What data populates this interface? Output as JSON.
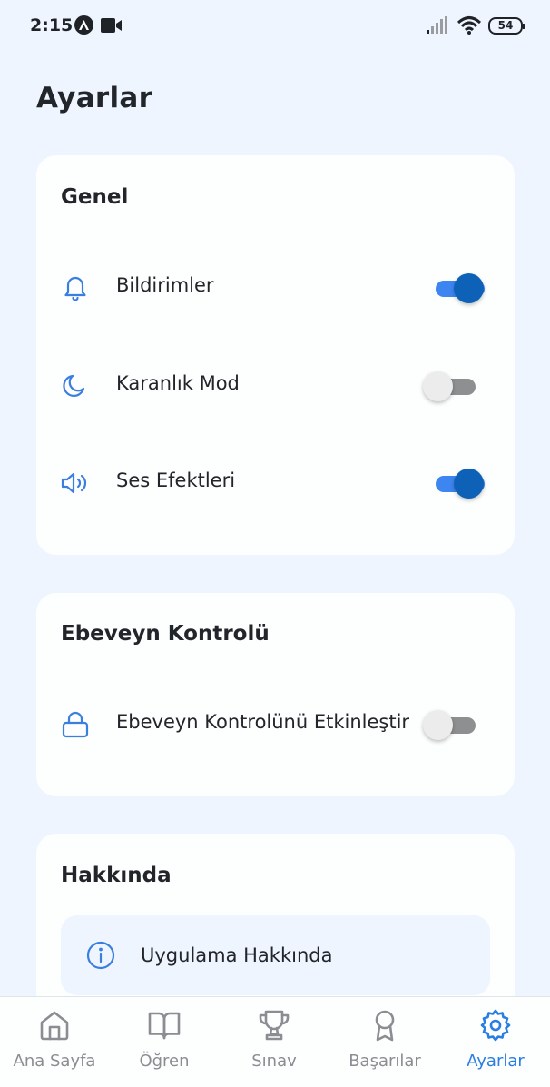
{
  "status_bar": {
    "time": "2:15",
    "battery": "54"
  },
  "page": {
    "title": "Ayarlar"
  },
  "general": {
    "title": "Genel",
    "items": [
      {
        "label": "Bildirimler",
        "icon": "bell-icon",
        "enabled": true
      },
      {
        "label": "Karanlık Mod",
        "icon": "moon-icon",
        "enabled": false
      },
      {
        "label": "Ses Efektleri",
        "icon": "speaker-icon",
        "enabled": true
      }
    ]
  },
  "parental": {
    "title": "Ebeveyn Kontrolü",
    "items": [
      {
        "label": "Ebeveyn Kontrolünü Etkinleştir",
        "icon": "lock-icon",
        "enabled": false
      }
    ]
  },
  "about": {
    "title": "Hakkında",
    "items": [
      {
        "label": "Uygulama Hakkında",
        "icon": "info-icon"
      }
    ]
  },
  "bottom_nav": {
    "items": [
      {
        "label": "Ana Sayfa",
        "icon": "home-icon",
        "active": false
      },
      {
        "label": "Öğren",
        "icon": "book-icon",
        "active": false
      },
      {
        "label": "Sınav",
        "icon": "trophy-icon",
        "active": false
      },
      {
        "label": "Başarılar",
        "icon": "award-icon",
        "active": false
      },
      {
        "label": "Ayarlar",
        "icon": "gear-icon",
        "active": true
      }
    ]
  },
  "colors": {
    "background": "#eef5ff",
    "card": "#fdfefe",
    "accent": "#2a7de1",
    "toggle_on_track": "#3d85f0",
    "toggle_on_thumb": "#0d62b8",
    "toggle_off_track": "#8e8f91",
    "toggle_off_thumb": "#ececec",
    "inactive_nav": "#8a8d91"
  }
}
